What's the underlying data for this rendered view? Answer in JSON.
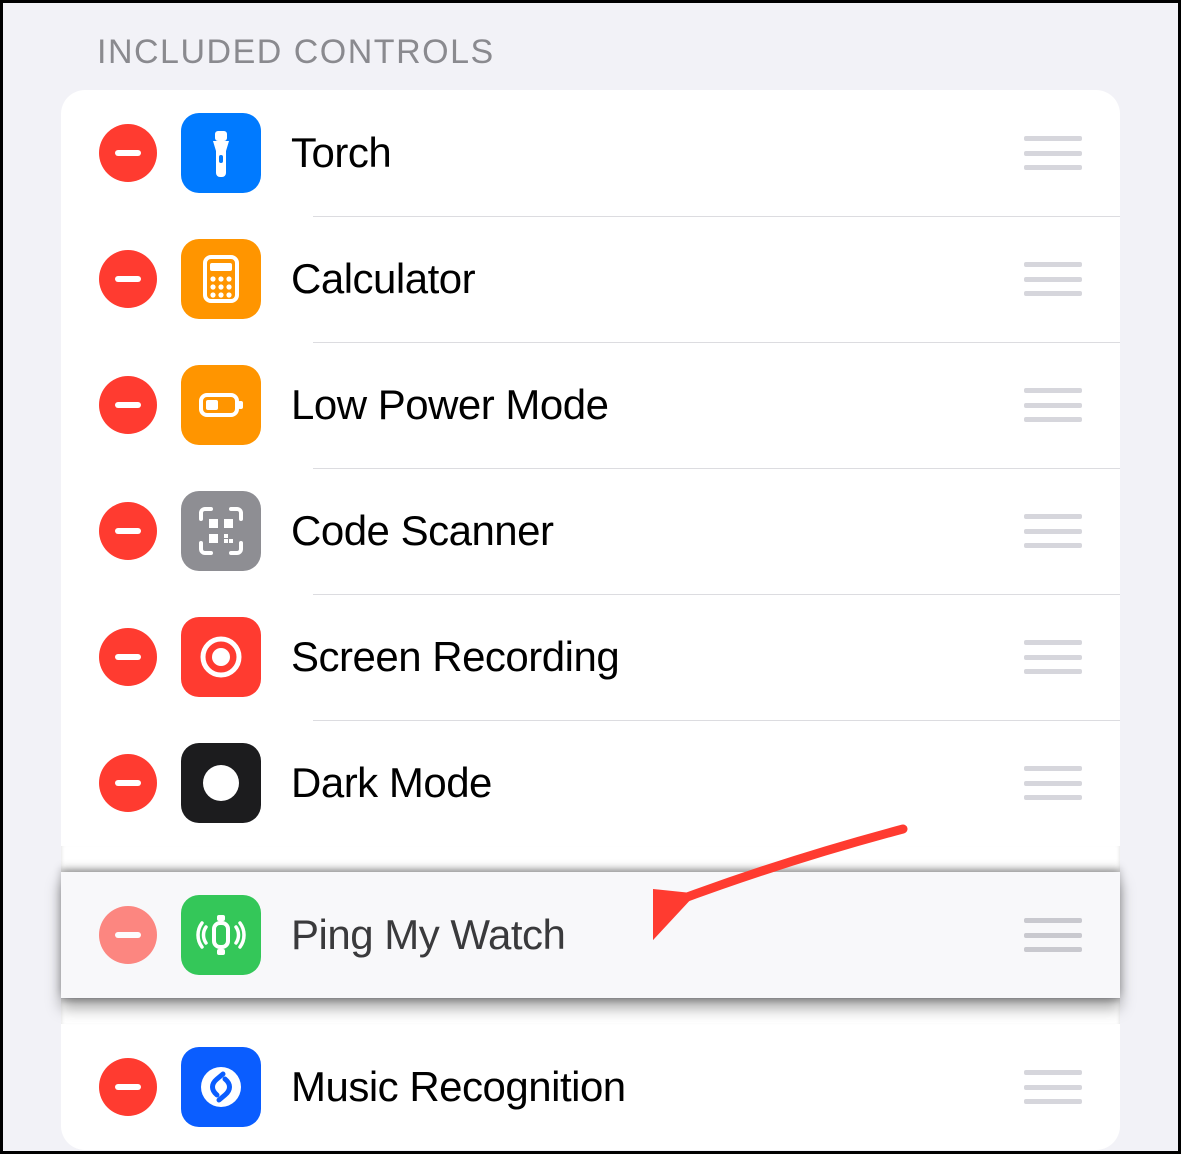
{
  "section_title": "INCLUDED CONTROLS",
  "controls": [
    {
      "id": "torch",
      "label": "Torch",
      "icon": "torch",
      "color": "bg-blue",
      "lifted": false
    },
    {
      "id": "calculator",
      "label": "Calculator",
      "icon": "calculator",
      "color": "bg-orange",
      "lifted": false
    },
    {
      "id": "low-power-mode",
      "label": "Low Power Mode",
      "icon": "battery",
      "color": "bg-orange",
      "lifted": false
    },
    {
      "id": "code-scanner",
      "label": "Code Scanner",
      "icon": "qr",
      "color": "bg-gray",
      "lifted": false
    },
    {
      "id": "screen-recording",
      "label": "Screen Recording",
      "icon": "record",
      "color": "bg-red",
      "lifted": false
    },
    {
      "id": "dark-mode",
      "label": "Dark Mode",
      "icon": "darkmode",
      "color": "bg-black",
      "lifted": false
    },
    {
      "id": "ping-my-watch",
      "label": "Ping My Watch",
      "icon": "pingwatch",
      "color": "bg-green",
      "lifted": true
    },
    {
      "id": "music-recognition",
      "label": "Music Recognition",
      "icon": "shazam",
      "color": "bg-indigo",
      "lifted": false
    }
  ],
  "annotation": {
    "target": "ping-my-watch",
    "kind": "arrow",
    "color": "#ff3b30"
  }
}
